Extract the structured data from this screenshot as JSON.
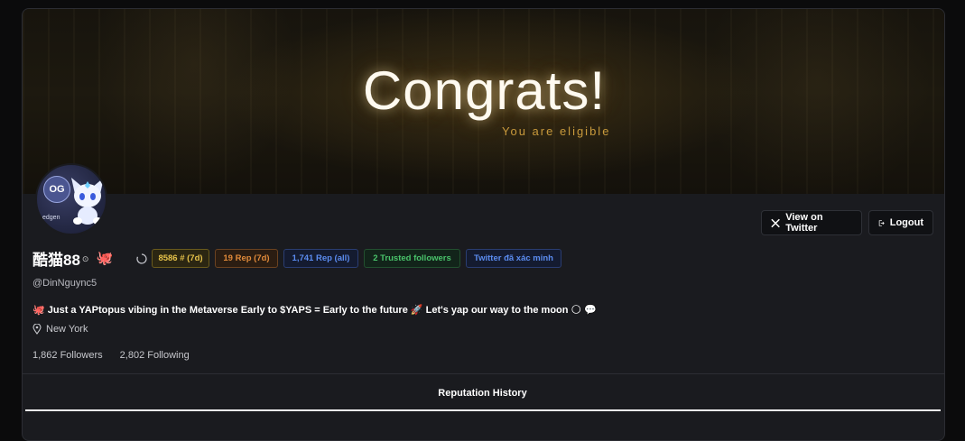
{
  "banner": {
    "title": "Congrats!",
    "subtitle": "You are eligible"
  },
  "avatar": {
    "badge_text": "OG",
    "caption": "edgen"
  },
  "actions": {
    "view_on_twitter": "View on Twitter",
    "logout": "Logout"
  },
  "profile": {
    "name": "酷猫88",
    "verified_mark": "⊙",
    "emoji": "🐙",
    "handle": "@DinNguync5",
    "bio": "🐙 Just a YAPtopus vibing in the Metaverse Early to $YAPS = Early to the future 🚀 Let's yap our way to the moon 🌕 💬",
    "location": "New York",
    "followers": "1,862 Followers",
    "following": "2,802 Following"
  },
  "badges": [
    {
      "label": "8586 # (7d)",
      "color": "#e6c24a"
    },
    {
      "label": "19 Rep (7d)",
      "color": "#e08a3a"
    },
    {
      "label": "1,741 Rep (all)",
      "color": "#5b8cf0"
    },
    {
      "label": "2 Trusted followers",
      "color": "#49c26a"
    },
    {
      "label": "Twitter đã xác minh",
      "color": "#5b8cf0"
    }
  ],
  "tabs": {
    "active": "Reputation History"
  }
}
